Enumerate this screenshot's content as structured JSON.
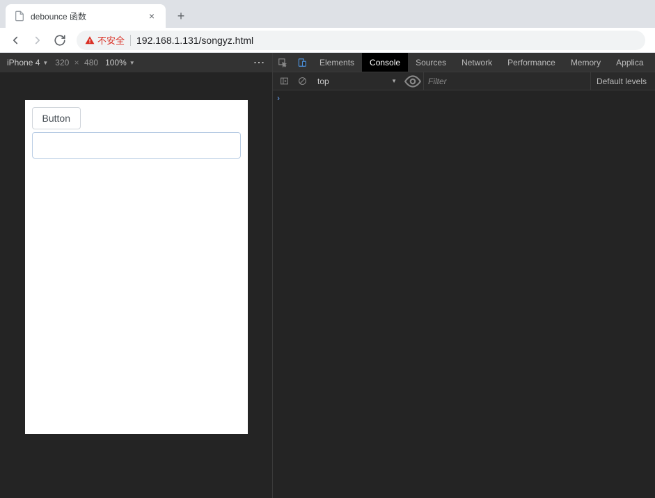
{
  "tab": {
    "title": "debounce 函数"
  },
  "address": {
    "security_label": "不安全",
    "url": "192.168.1.131/songyz.html"
  },
  "device_toolbar": {
    "device": "iPhone 4",
    "width": "320",
    "height": "480",
    "zoom": "100%"
  },
  "page": {
    "button_label": "Button",
    "input_value": ""
  },
  "devtools": {
    "tabs": {
      "elements": "Elements",
      "console": "Console",
      "sources": "Sources",
      "network": "Network",
      "performance": "Performance",
      "memory": "Memory",
      "application": "Applica"
    },
    "console_toolbar": {
      "context": "top",
      "filter_placeholder": "Filter",
      "levels": "Default levels"
    }
  }
}
